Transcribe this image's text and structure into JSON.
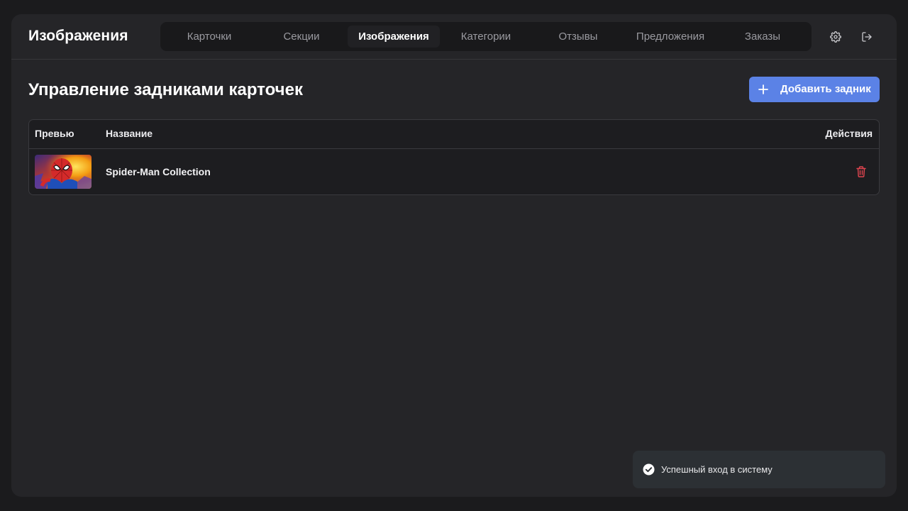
{
  "app": {
    "title": "Изображения"
  },
  "nav": {
    "tabs": [
      {
        "label": "Карточки"
      },
      {
        "label": "Секции"
      },
      {
        "label": "Изображения",
        "active": true
      },
      {
        "label": "Категории"
      },
      {
        "label": "Отзывы"
      },
      {
        "label": "Предложения"
      },
      {
        "label": "Заказы"
      }
    ]
  },
  "header_icons": [
    "gear-icon",
    "logout-icon"
  ],
  "page": {
    "title": "Управление задниками карточек",
    "add_button_label": "Добавить задник"
  },
  "table": {
    "columns": [
      "Превью",
      "Название",
      "Действия"
    ],
    "rows": [
      {
        "name": "Spider-Man Collection",
        "preview_icon": "spider-man-image",
        "action_icon": "trash-icon"
      }
    ]
  },
  "toast": {
    "message": "Успешный вход в систему",
    "icon": "check-circle-icon"
  },
  "colors": {
    "accent": "#5b82e6",
    "danger": "#e0454f",
    "background": "#252528",
    "nav_bg": "#19191b",
    "toast_bg": "#2c3034"
  }
}
